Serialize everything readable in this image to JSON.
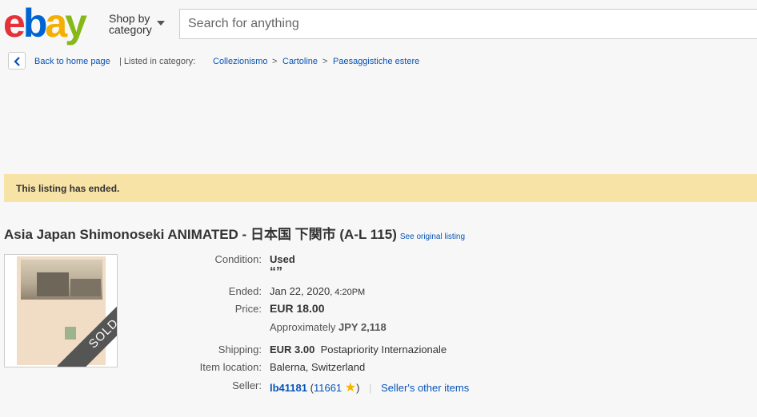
{
  "header": {
    "logo_letters": [
      "e",
      "b",
      "a",
      "y"
    ],
    "logo_colors": [
      "#e53238",
      "#0064d2",
      "#f5af02",
      "#86b817"
    ],
    "shop_by_line1": "Shop by",
    "shop_by_line2": "category",
    "search_placeholder": "Search for anything"
  },
  "breadcrumb": {
    "back_label": "Back to home page",
    "listed_label": "| Listed in category:",
    "items": [
      "Collezionismo",
      "Cartoline",
      "Paesaggistiche estere"
    ],
    "separator": ">"
  },
  "banner": {
    "text": "This listing has ended."
  },
  "listing": {
    "title": "Asia Japan Shimonoseki ANIMATED - 日本国 下関市 (A-L 115)",
    "see_original": "See original listing",
    "sold_badge": "SOLD",
    "condition_label": "Condition:",
    "condition_value": "Used",
    "condition_note": "“”",
    "ended_label": "Ended:",
    "ended_date": "Jan 22, 2020",
    "ended_time": ", 4:20PM",
    "price_label": "Price:",
    "price_value": "EUR 18.00",
    "approx_label": "Approximately",
    "approx_value": "JPY 2,118",
    "shipping_label": "Shipping:",
    "shipping_value": "EUR 3.00",
    "shipping_method": "Postapriority Internazionale",
    "location_label": "Item location:",
    "location_value": "Balerna, Switzerland",
    "seller_label": "Seller:",
    "seller_name": "lb41181",
    "seller_open": "(",
    "seller_score": "11661",
    "seller_close": ")",
    "seller_other": "Seller's other items"
  }
}
